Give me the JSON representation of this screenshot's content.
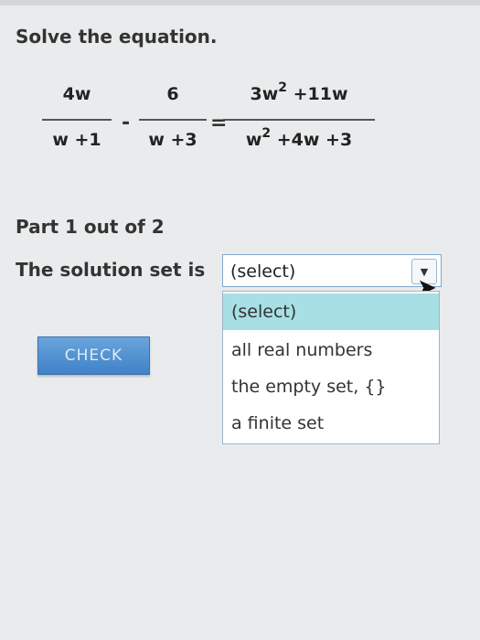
{
  "header": {
    "title": "Solve the equation."
  },
  "equation": {
    "frac1": {
      "num": "4w",
      "den": "w +1"
    },
    "minus": "-",
    "frac2": {
      "num": "6",
      "den": "w +3"
    },
    "equals": "=",
    "frac3": {
      "num_a": "3w",
      "num_exp": "2",
      "num_b": " +11w",
      "den_a": "w",
      "den_exp": "2",
      "den_b": " +4w +3"
    }
  },
  "part": {
    "label": "Part 1 out of 2"
  },
  "solution": {
    "label": "The solution set is",
    "selected": "(select)",
    "options": [
      "(select)",
      "all real numbers",
      "the empty set, {}",
      "a finite set"
    ]
  },
  "check_button": {
    "label": "CHECK"
  }
}
